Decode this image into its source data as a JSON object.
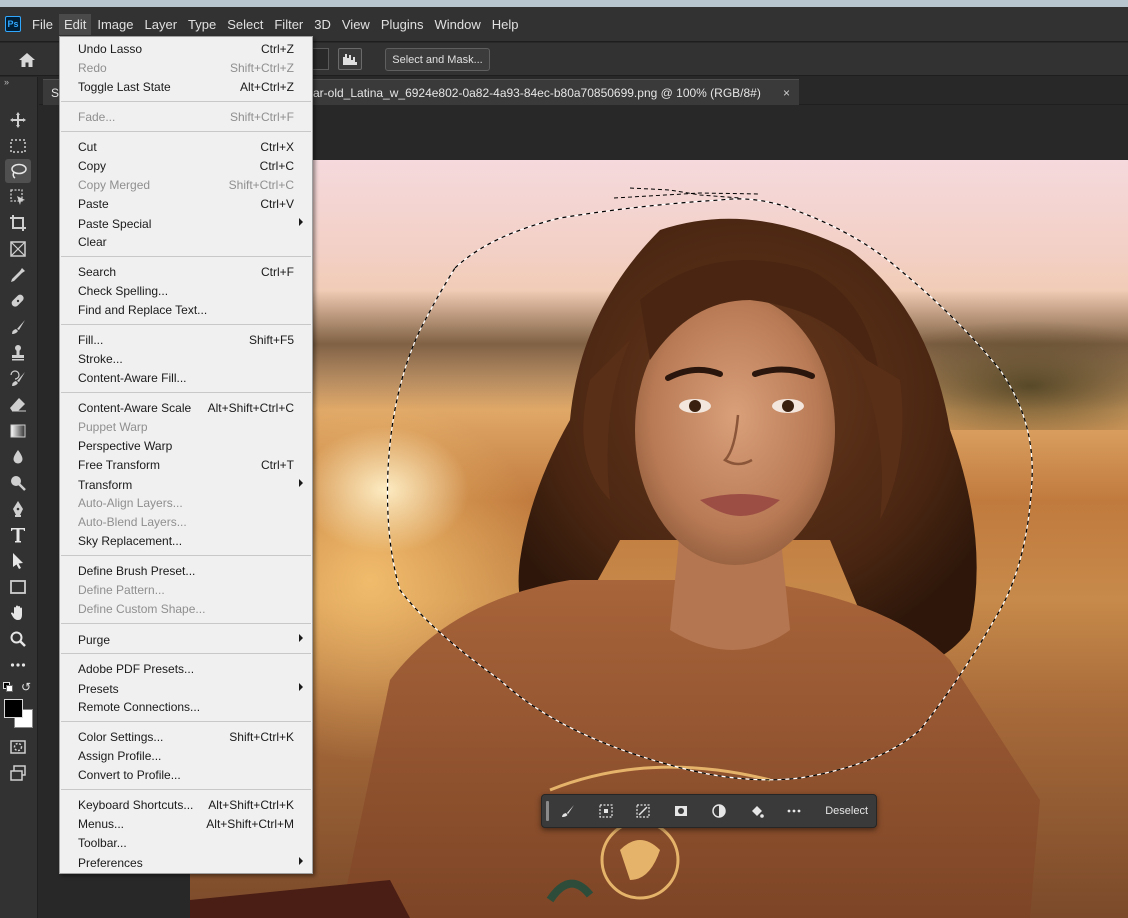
{
  "app": {
    "logo": "Ps"
  },
  "menubar": {
    "items": [
      "File",
      "Edit",
      "Image",
      "Layer",
      "Type",
      "Select",
      "Filter",
      "3D",
      "View",
      "Plugins",
      "Window",
      "Help"
    ]
  },
  "options_bar": {
    "select_and_mask_label": "Select and Mask..."
  },
  "document": {
    "tab_left_fragment": "Sy",
    "tab_title": "ar-old_Latina_w_6924e802-0a82-4a93-84ec-b80a70850699.png @ 100% (RGB/8#)",
    "tab_close": "×"
  },
  "contextual_taskbar": {
    "deselect_label": "Deselect"
  },
  "edit_menu": {
    "items": [
      {
        "label": "Undo Lasso",
        "shortcut": "Ctrl+Z",
        "disabled": false
      },
      {
        "label": "Redo",
        "shortcut": "Shift+Ctrl+Z",
        "disabled": true
      },
      {
        "label": "Toggle Last State",
        "shortcut": "Alt+Ctrl+Z",
        "disabled": false
      },
      {
        "label": "Fade...",
        "shortcut": "Shift+Ctrl+F",
        "disabled": true
      },
      {
        "label": "Cut",
        "shortcut": "Ctrl+X",
        "disabled": false
      },
      {
        "label": "Copy",
        "shortcut": "Ctrl+C",
        "disabled": false
      },
      {
        "label": "Copy Merged",
        "shortcut": "Shift+Ctrl+C",
        "disabled": true
      },
      {
        "label": "Paste",
        "shortcut": "Ctrl+V",
        "disabled": false
      },
      {
        "label": "Paste Special",
        "shortcut": "",
        "disabled": false,
        "submenu": true
      },
      {
        "label": "Clear",
        "shortcut": "",
        "disabled": false
      },
      {
        "label": "Search",
        "shortcut": "Ctrl+F",
        "disabled": false
      },
      {
        "label": "Check Spelling...",
        "shortcut": "",
        "disabled": false
      },
      {
        "label": "Find and Replace Text...",
        "shortcut": "",
        "disabled": false
      },
      {
        "label": "Fill...",
        "shortcut": "Shift+F5",
        "disabled": false
      },
      {
        "label": "Stroke...",
        "shortcut": "",
        "disabled": false
      },
      {
        "label": "Content-Aware Fill...",
        "shortcut": "",
        "disabled": false
      },
      {
        "label": "Content-Aware Scale",
        "shortcut": "Alt+Shift+Ctrl+C",
        "disabled": false
      },
      {
        "label": "Puppet Warp",
        "shortcut": "",
        "disabled": true
      },
      {
        "label": "Perspective Warp",
        "shortcut": "",
        "disabled": false
      },
      {
        "label": "Free Transform",
        "shortcut": "Ctrl+T",
        "disabled": false
      },
      {
        "label": "Transform",
        "shortcut": "",
        "disabled": false,
        "submenu": true
      },
      {
        "label": "Auto-Align Layers...",
        "shortcut": "",
        "disabled": true
      },
      {
        "label": "Auto-Blend Layers...",
        "shortcut": "",
        "disabled": true
      },
      {
        "label": "Sky Replacement...",
        "shortcut": "",
        "disabled": false
      },
      {
        "label": "Define Brush Preset...",
        "shortcut": "",
        "disabled": false
      },
      {
        "label": "Define Pattern...",
        "shortcut": "",
        "disabled": true
      },
      {
        "label": "Define Custom Shape...",
        "shortcut": "",
        "disabled": true
      },
      {
        "label": "Purge",
        "shortcut": "",
        "disabled": false,
        "submenu": true
      },
      {
        "label": "Adobe PDF Presets...",
        "shortcut": "",
        "disabled": false
      },
      {
        "label": "Presets",
        "shortcut": "",
        "disabled": false,
        "submenu": true
      },
      {
        "label": "Remote Connections...",
        "shortcut": "",
        "disabled": false
      },
      {
        "label": "Color Settings...",
        "shortcut": "Shift+Ctrl+K",
        "disabled": false
      },
      {
        "label": "Assign Profile...",
        "shortcut": "",
        "disabled": false
      },
      {
        "label": "Convert to Profile...",
        "shortcut": "",
        "disabled": false
      },
      {
        "label": "Keyboard Shortcuts...",
        "shortcut": "Alt+Shift+Ctrl+K",
        "disabled": false
      },
      {
        "label": "Menus...",
        "shortcut": "Alt+Shift+Ctrl+M",
        "disabled": false
      },
      {
        "label": "Toolbar...",
        "shortcut": "",
        "disabled": false
      },
      {
        "label": "Preferences",
        "shortcut": "",
        "disabled": false,
        "submenu": true
      }
    ]
  },
  "tools": [
    {
      "name": "move-tool-icon"
    },
    {
      "name": "marquee-tool-icon"
    },
    {
      "name": "lasso-tool-icon",
      "active": true
    },
    {
      "name": "object-selection-tool-icon"
    },
    {
      "name": "crop-tool-icon"
    },
    {
      "name": "frame-tool-icon"
    },
    {
      "name": "eyedropper-tool-icon"
    },
    {
      "name": "healing-brush-tool-icon"
    },
    {
      "name": "brush-tool-icon"
    },
    {
      "name": "clone-stamp-tool-icon"
    },
    {
      "name": "history-brush-tool-icon"
    },
    {
      "name": "eraser-tool-icon"
    },
    {
      "name": "gradient-tool-icon"
    },
    {
      "name": "blur-tool-icon"
    },
    {
      "name": "dodge-tool-icon"
    },
    {
      "name": "pen-tool-icon"
    },
    {
      "name": "type-tool-icon"
    },
    {
      "name": "path-selection-tool-icon"
    },
    {
      "name": "rectangle-tool-icon"
    },
    {
      "name": "hand-tool-icon"
    },
    {
      "name": "zoom-tool-icon"
    },
    {
      "name": "more-tools-icon"
    }
  ],
  "colors": {
    "foreground": "#000000",
    "background": "#ffffff",
    "accent": "#31a8ff"
  }
}
